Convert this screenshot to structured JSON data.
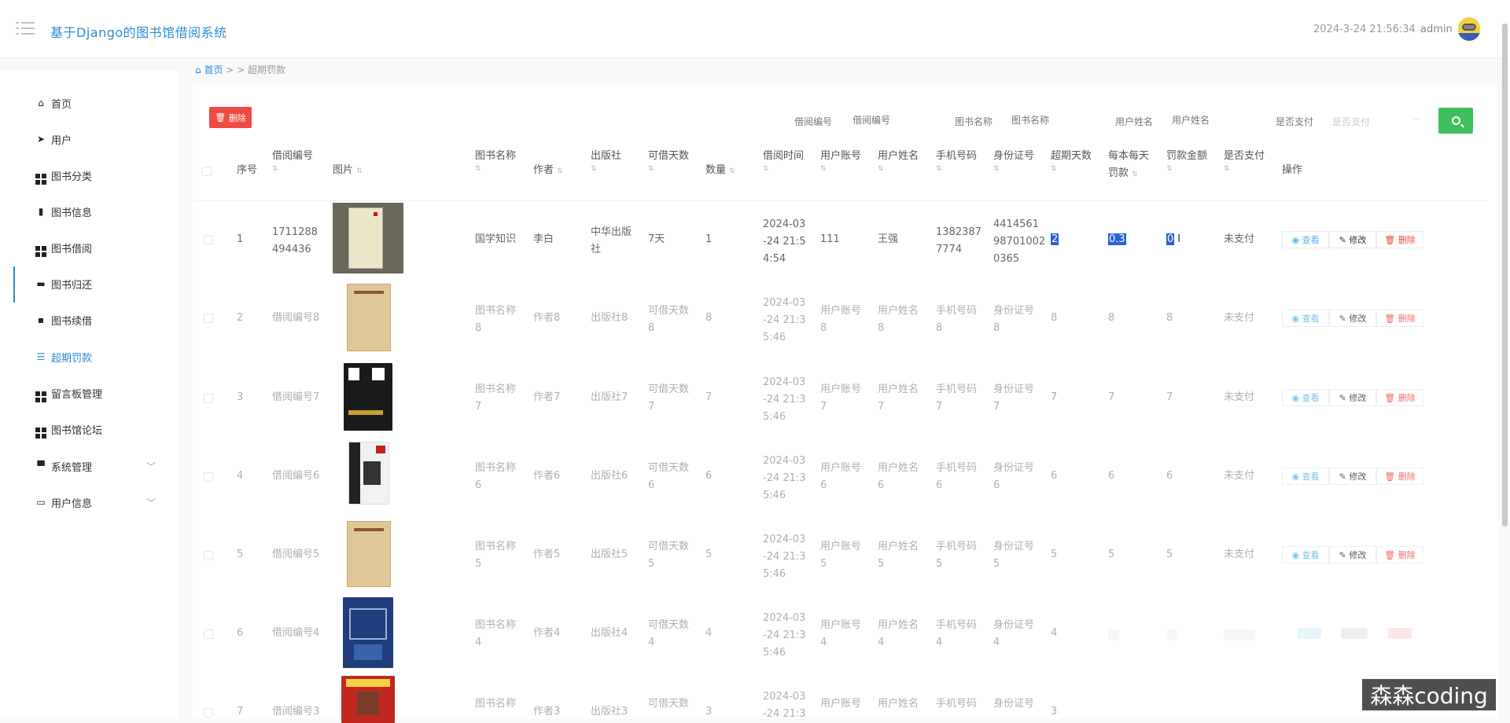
{
  "header": {
    "title": "基于Django的图书馆借阅系统",
    "datetime": "2024-3-24 21:56:34",
    "user": "admin"
  },
  "breadcrumb": {
    "home": "首页",
    "sep": " > > ",
    "current": "超期罚款"
  },
  "sidebar": {
    "items": [
      {
        "label": "首页",
        "icon": "home-icon"
      },
      {
        "label": "用户",
        "icon": "paper-plane-icon"
      },
      {
        "label": "图书分类",
        "icon": "grid-icon"
      },
      {
        "label": "图书信息",
        "icon": "bar-chart-icon"
      },
      {
        "label": "图书借阅",
        "icon": "grid-icon"
      },
      {
        "label": "图书归还",
        "icon": "briefcase-icon"
      },
      {
        "label": "图书续借",
        "icon": "chat-icon"
      },
      {
        "label": "超期罚款",
        "icon": "list-icon"
      },
      {
        "label": "留言板管理",
        "icon": "grid-icon"
      },
      {
        "label": "图书馆论坛",
        "icon": "grid-icon"
      },
      {
        "label": "系统管理",
        "icon": "monitor-icon"
      },
      {
        "label": "用户信息",
        "icon": "card-icon"
      }
    ]
  },
  "toolbar": {
    "delete_label": "删除"
  },
  "filters": {
    "borrow_no": {
      "label": "借阅编号",
      "placeholder": "借阅编号"
    },
    "book_name": {
      "label": "图书名称",
      "placeholder": "图书名称"
    },
    "user_name": {
      "label": "用户姓名",
      "placeholder": "用户姓名"
    },
    "paid": {
      "label": "是否支付",
      "placeholder": "是否支付"
    }
  },
  "table": {
    "headers": {
      "index": "序号",
      "borrow_no": "借阅编号",
      "image": "图片",
      "book_name": "图书名称",
      "author": "作者",
      "publisher": "出版社",
      "days": "可借天数",
      "qty": "数量",
      "borrow_time": "借阅时间",
      "account": "用户账号",
      "user_name": "用户姓名",
      "phone": "手机号码",
      "id_card": "身份证号",
      "overdue_days": "超期天数",
      "daily_fine_1": "每本每天",
      "daily_fine_2": "罚款",
      "fine": "罚款金额",
      "paid": "是否支付",
      "ops": "操作"
    },
    "ops": {
      "view": "查看",
      "edit": "修改",
      "delete": "删除"
    },
    "rows": [
      {
        "idx": "1",
        "no_1": "1711288",
        "no_2": "494436",
        "name_1": "国学知识",
        "name_2": "",
        "author": "李白",
        "pub_1": "中华出版",
        "pub_2": "社",
        "days_1": "7天",
        "days_2": "",
        "qty": "1",
        "t1": "2024-03",
        "t2": "-24 21:5",
        "t3": "4:54",
        "acct": "111",
        "uname_1": "王强",
        "uname_2": "",
        "phone_1": "1382387",
        "phone_2": "7774",
        "id_1": "4414561",
        "id_2": "98701002",
        "id_3": "0365",
        "od": "2",
        "df": "0.3",
        "fine": "0",
        "paid": "未支付"
      },
      {
        "idx": "2",
        "no_1": "借阅编号8",
        "no_2": "",
        "name_1": "图书名称",
        "name_2": "8",
        "author": "作者8",
        "pub_1": "出版社8",
        "pub_2": "",
        "days_1": "可借天数",
        "days_2": "8",
        "qty": "8",
        "t1": "2024-03",
        "t2": "-24 21:3",
        "t3": "5:46",
        "acct": "用户账号",
        "acct_2": "8",
        "uname_1": "用户姓名",
        "uname_2": "8",
        "phone_1": "手机号码",
        "phone_2": "8",
        "id_1": "身份证号",
        "id_2": "8",
        "id_3": "",
        "od": "8",
        "df": "8",
        "fine": "8",
        "paid": "未支付"
      },
      {
        "idx": "3",
        "no_1": "借阅编号7",
        "no_2": "",
        "name_1": "图书名称",
        "name_2": "7",
        "author": "作者7",
        "pub_1": "出版社7",
        "pub_2": "",
        "days_1": "可借天数",
        "days_2": "7",
        "qty": "7",
        "t1": "2024-03",
        "t2": "-24 21:3",
        "t3": "5:46",
        "acct": "用户账号",
        "acct_2": "7",
        "uname_1": "用户姓名",
        "uname_2": "7",
        "phone_1": "手机号码",
        "phone_2": "7",
        "id_1": "身份证号",
        "id_2": "7",
        "id_3": "",
        "od": "7",
        "df": "7",
        "fine": "7",
        "paid": "未支付"
      },
      {
        "idx": "4",
        "no_1": "借阅编号6",
        "no_2": "",
        "name_1": "图书名称",
        "name_2": "6",
        "author": "作者6",
        "pub_1": "出版社6",
        "pub_2": "",
        "days_1": "可借天数",
        "days_2": "6",
        "qty": "6",
        "t1": "2024-03",
        "t2": "-24 21:3",
        "t3": "5:46",
        "acct": "用户账号",
        "acct_2": "6",
        "uname_1": "用户姓名",
        "uname_2": "6",
        "phone_1": "手机号码",
        "phone_2": "6",
        "id_1": "身份证号",
        "id_2": "6",
        "id_3": "",
        "od": "6",
        "df": "6",
        "fine": "6",
        "paid": "未支付"
      },
      {
        "idx": "5",
        "no_1": "借阅编号5",
        "no_2": "",
        "name_1": "图书名称",
        "name_2": "5",
        "author": "作者5",
        "pub_1": "出版社5",
        "pub_2": "",
        "days_1": "可借天数",
        "days_2": "5",
        "qty": "5",
        "t1": "2024-03",
        "t2": "-24 21:3",
        "t3": "5:46",
        "acct": "用户账号",
        "acct_2": "5",
        "uname_1": "用户姓名",
        "uname_2": "5",
        "phone_1": "手机号码",
        "phone_2": "5",
        "id_1": "身份证号",
        "id_2": "5",
        "id_3": "",
        "od": "5",
        "df": "5",
        "fine": "5",
        "paid": "未支付"
      },
      {
        "idx": "6",
        "no_1": "借阅编号4",
        "no_2": "",
        "name_1": "图书名称",
        "name_2": "4",
        "author": "作者4",
        "pub_1": "出版社4",
        "pub_2": "",
        "days_1": "可借天数",
        "days_2": "4",
        "qty": "4",
        "t1": "2024-03",
        "t2": "-24 21:3",
        "t3": "5:46",
        "acct": "用户账号",
        "acct_2": "4",
        "uname_1": "用户姓名",
        "uname_2": "4",
        "phone_1": "手机号码",
        "phone_2": "4",
        "id_1": "身份证号",
        "id_2": "4",
        "id_3": "",
        "od": "4"
      },
      {
        "idx": "7",
        "no_1": "借阅编号3",
        "no_2": "",
        "name_1": "图书名称",
        "name_2": "",
        "author": "作者3",
        "pub_1": "出版社3",
        "pub_2": "",
        "days_1": "可借天数",
        "days_2": "",
        "qty": "3",
        "t1": "2024-03",
        "t2": "-24 21:3",
        "t3": "",
        "acct": "用户账号",
        "acct_2": "",
        "uname_1": "用户姓名",
        "uname_2": "",
        "phone_1": "手机号码",
        "phone_2": "",
        "id_1": "身份证号",
        "id_2": "",
        "id_3": "",
        "od": "3"
      }
    ]
  },
  "watermark": "森森coding",
  "colors": {
    "accent": "#2e8bd6",
    "danger": "#ee4b44",
    "success": "#3fbf5c",
    "selection": "#2c5fd0"
  }
}
